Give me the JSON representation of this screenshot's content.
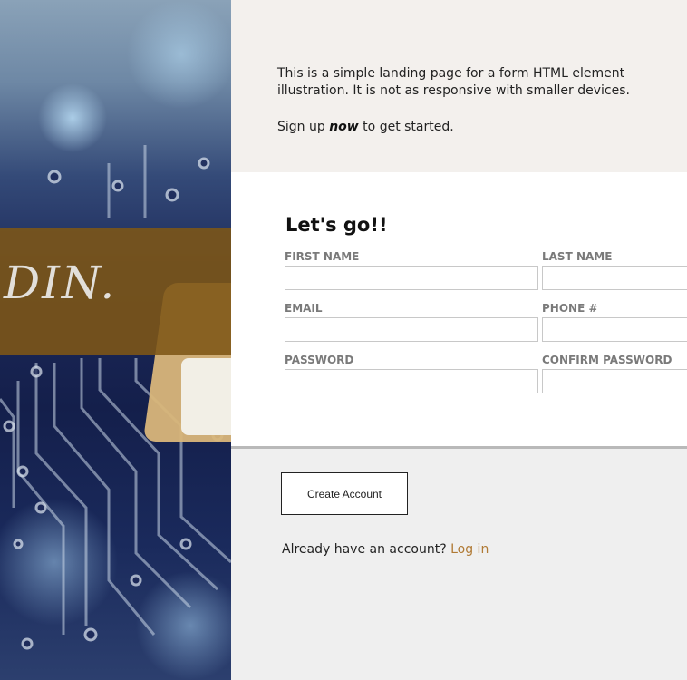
{
  "hero": {
    "text": "DIN."
  },
  "intro": {
    "description": "This is a simple landing page for a form HTML element illustration. It is not as responsive with smaller devices.",
    "cta_prefix": "Sign up ",
    "cta_emphasis": "now",
    "cta_suffix": " to get started."
  },
  "form": {
    "title": "Let's go!!",
    "fields": [
      {
        "label": "FIRST NAME",
        "value": "",
        "placeholder": ""
      },
      {
        "label": "LAST NAME",
        "value": "",
        "placeholder": ""
      },
      {
        "label": "EMAIL",
        "value": "",
        "placeholder": ""
      },
      {
        "label": "PHONE #",
        "value": "",
        "placeholder": ""
      },
      {
        "label": "PASSWORD",
        "value": "",
        "placeholder": ""
      },
      {
        "label": "CONFIRM PASSWORD",
        "value": "",
        "placeholder": ""
      }
    ]
  },
  "actions": {
    "create_label": "Create Account",
    "login_prompt": "Already have an account? ",
    "login_link": "Log in"
  },
  "colors": {
    "accent": "#b07a35",
    "band": "#7e5616",
    "intro_bg": "#f3f0ed",
    "actions_bg": "#efefef"
  }
}
